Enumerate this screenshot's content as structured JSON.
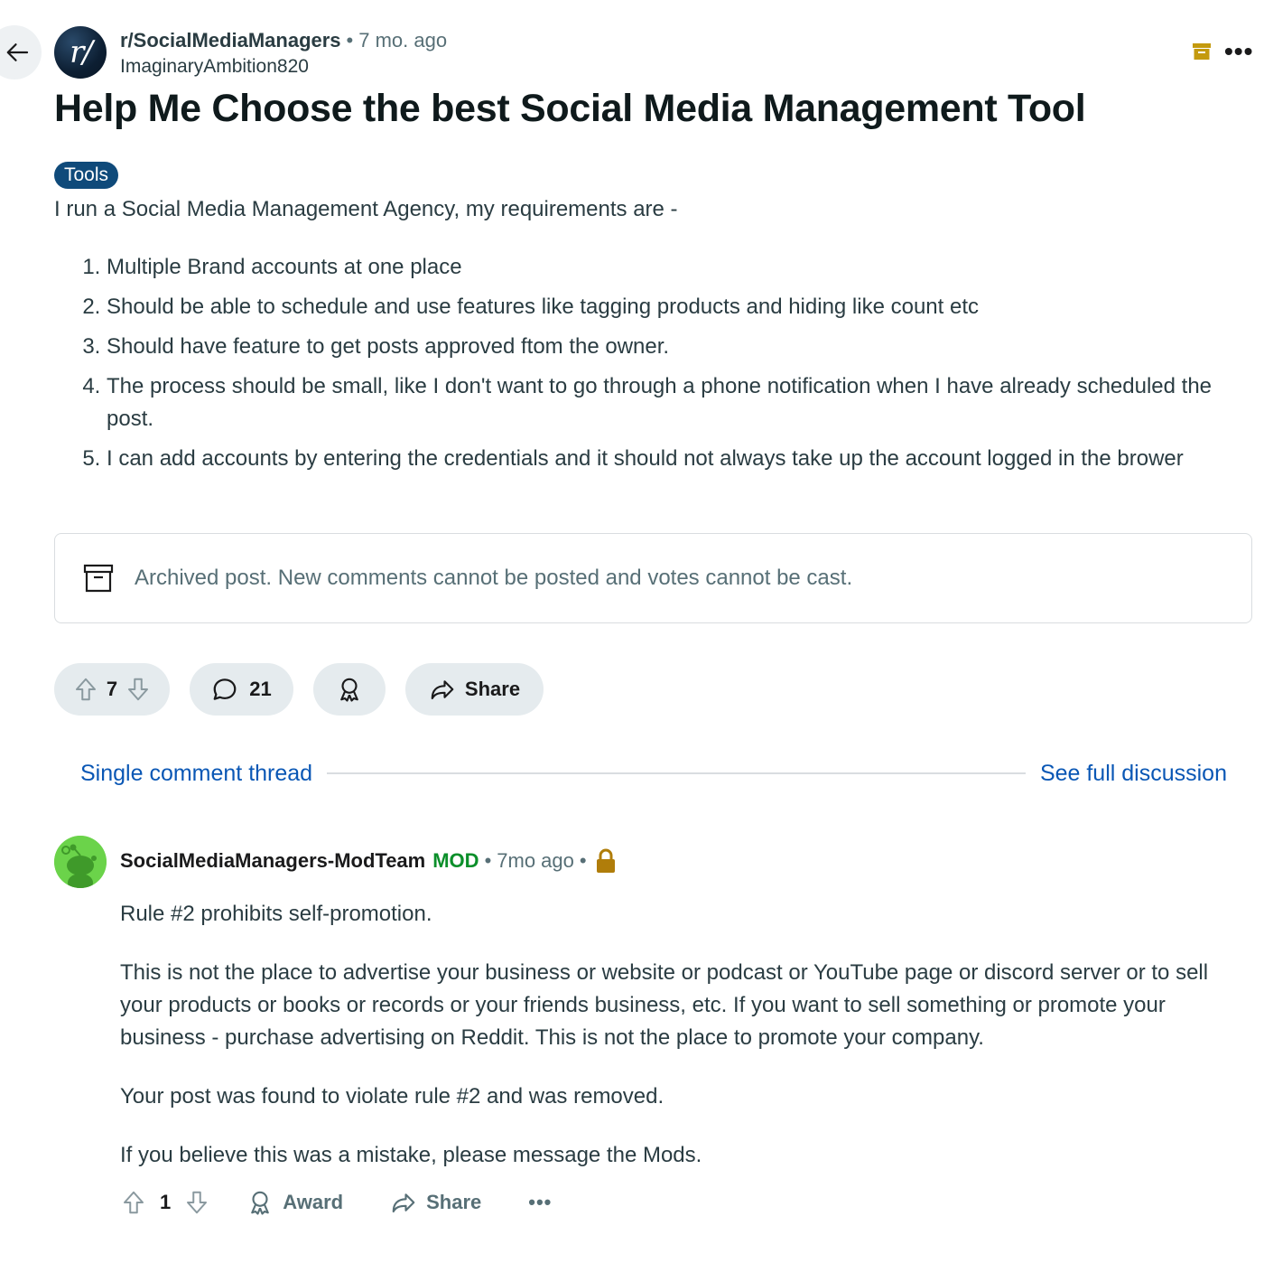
{
  "post": {
    "subreddit": "r/SocialMediaManagers",
    "age": "7 mo. ago",
    "author": "ImaginaryAmbition820",
    "title": "Help Me Choose the best Social Media Management Tool",
    "flair": "Tools",
    "intro": "I run a Social Media Management Agency, my requirements are -",
    "requirements": [
      "Multiple Brand accounts at one place",
      "Should be able to schedule and use features like tagging products and hiding like count etc",
      "Should have feature to get posts approved ftom the owner.",
      "The process should be small, like I don't want to go through a phone notification when I have already scheduled the post.",
      "I can add accounts by entering the credentials and it should not always take up the account logged in the brower"
    ],
    "archived_notice": "Archived post. New comments cannot be posted and votes cannot be cast.",
    "votes": "7",
    "comments": "21",
    "share_label": "Share"
  },
  "thread_nav": {
    "single_label": "Single comment thread",
    "full_label": "See full discussion"
  },
  "comment": {
    "author": "SocialMediaManagers-ModTeam",
    "mod_tag": "MOD",
    "age": "7mo ago",
    "paragraphs": [
      "Rule #2 prohibits self-promotion.",
      "This is not the place to advertise your business or website or podcast or YouTube page or discord server or to sell your products or books or records or your friends business, etc. If you want to sell something or promote your business - purchase advertising on Reddit. This is not the place to promote your company.",
      "Your post was found to violate rule #2 and was removed.",
      "If you believe this was a mistake, please message the Mods."
    ],
    "votes": "1",
    "award_label": "Award",
    "share_label": "Share"
  },
  "icons": {
    "back": "arrow-left-icon",
    "archive": "archive-box-icon",
    "more": "more-horizontal-icon",
    "upvote": "arrow-up-outline-icon",
    "downvote": "arrow-down-outline-icon",
    "comment": "speech-bubble-icon",
    "award": "award-ribbon-icon",
    "share": "share-arrow-icon",
    "lock": "lock-icon"
  },
  "colors": {
    "flair_bg": "#0f4a7a",
    "link": "#0a57b5",
    "mod_green": "#0b8f2a",
    "archive_gold": "#c49a0e",
    "lock_brown": "#b07d0a",
    "pill_bg": "#e5ebee"
  }
}
